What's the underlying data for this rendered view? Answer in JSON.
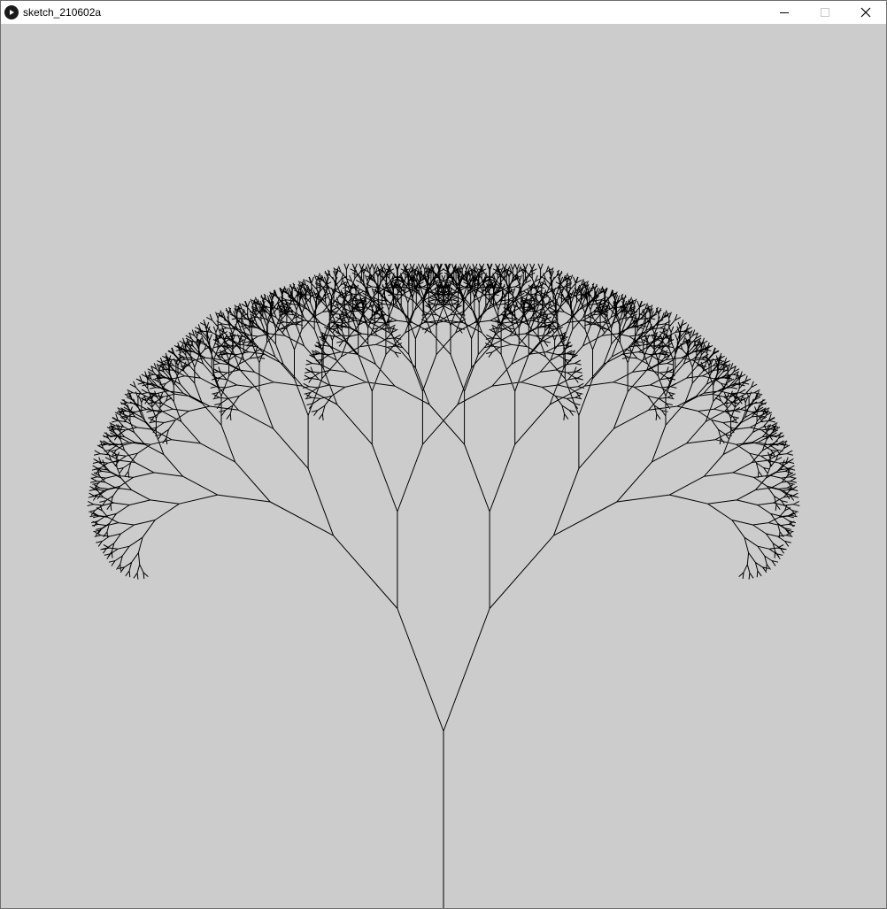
{
  "window": {
    "title": "sketch_210602a",
    "icon": "play-circle-icon",
    "controls": [
      "minimize-icon",
      "maximize-icon",
      "close-icon"
    ]
  },
  "canvas": {
    "background": "#cccccc",
    "stroke": "#000000",
    "drawing": "recursive-fractal-tree"
  }
}
